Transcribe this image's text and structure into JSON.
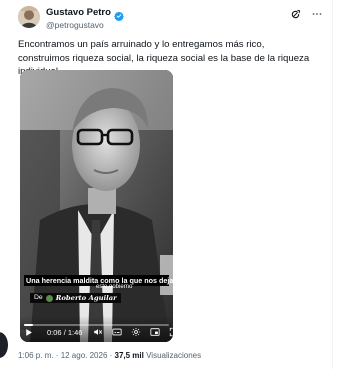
{
  "tweet": {
    "author": {
      "name": "Gustavo Petro",
      "handle": "@petrogustavo",
      "verified": true
    },
    "text": "Encontramos un país arruinado y lo entregamos más rico, construimos riqueza social, la riqueza social es la base de la riqueza individual",
    "actions": {
      "grok_icon": "grok-icon",
      "more_icon": "more-icon"
    },
    "video": {
      "caption_main": "Una herencia maldita como la que nos deja",
      "caption_sub": "este gobierno",
      "credit_prefix": "De",
      "credit_author": "Roberto Aguilar",
      "current_time": "0:06",
      "duration": "1:46",
      "time_separator": " / ",
      "progress": 0.06
    },
    "meta": {
      "time": "1:06 p. m.",
      "separator": " · ",
      "date": "12 ago. 2026",
      "views": "37,5 mil",
      "views_label": "Visualizaciones"
    }
  },
  "colors": {
    "text_primary": "#0f1419",
    "text_secondary": "#536471",
    "verified_blue": "#1d9bf0",
    "border": "#eff3f4"
  }
}
